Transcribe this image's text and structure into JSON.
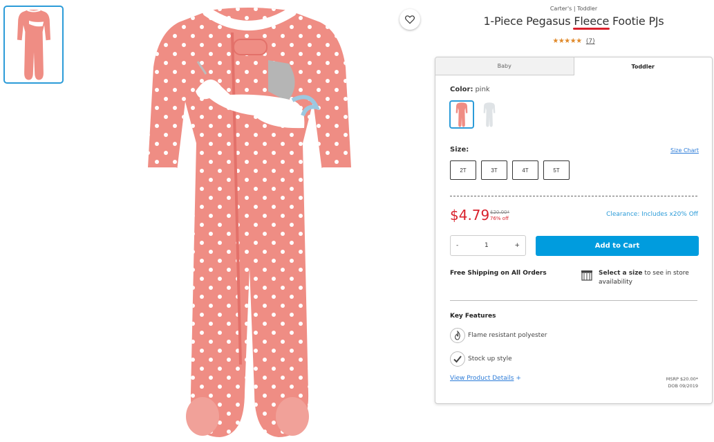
{
  "product": {
    "brand_line": "Carter's | Toddler",
    "title_before": "1-Piece Pegasus ",
    "title_highlight": "Fleece",
    "title_after": " Footie PJs",
    "stars": "★★★★★",
    "review_count": "(7)",
    "rating": 5
  },
  "tabs": [
    {
      "label": "Baby",
      "active": false
    },
    {
      "label": "Toddler",
      "active": true
    }
  ],
  "color": {
    "label": "Color:",
    "value": "pink",
    "swatches": [
      "pink",
      "gray"
    ]
  },
  "size": {
    "label": "Size:",
    "chart_link": "Size Chart",
    "options": [
      "2T",
      "3T",
      "4T",
      "5T"
    ]
  },
  "pricing": {
    "price": "$4.79",
    "original": "$20.00*",
    "discount": "76% off",
    "clearance": "Clearance: Includes x20% Off"
  },
  "quantity": {
    "minus": "-",
    "value": "1",
    "plus": "+"
  },
  "cart": {
    "add_label": "Add to Cart"
  },
  "shipping": {
    "free": "Free Shipping on All Orders",
    "store_bold": "Select a size",
    "store_rest": " to see in store availability"
  },
  "features": {
    "title": "Key Features",
    "items": [
      "Flame resistant polyester",
      "Stock up style"
    ],
    "view_details": "View Product Details",
    "view_plus": "+"
  },
  "msrp": {
    "line1": "MSRP $20.00*",
    "line2": "DOB 09/2019"
  },
  "colors": {
    "accent_blue": "#009cde",
    "sale_red": "#d9212c",
    "star_orange": "#e0892a",
    "pj_pink": "#ef8d84"
  },
  "icons": [
    "heart-icon",
    "store-icon",
    "flame-icon",
    "checkmark-icon"
  ]
}
